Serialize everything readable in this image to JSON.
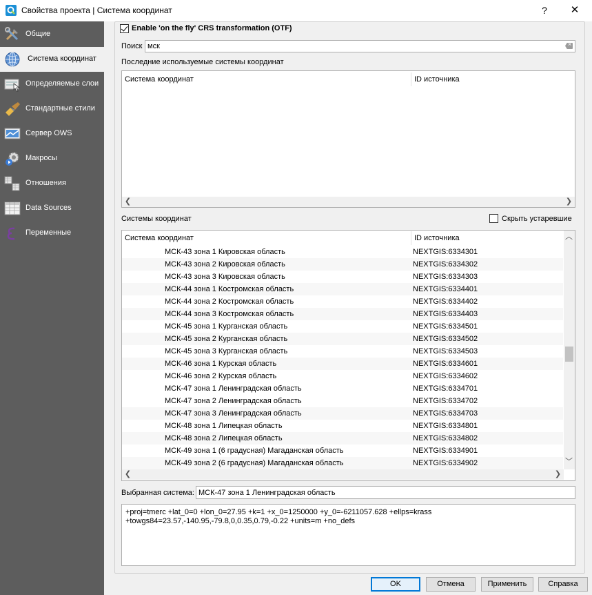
{
  "window": {
    "title": "Свойства проекта | Система координат",
    "help_label": "?",
    "close_label": "✕"
  },
  "sidebar": {
    "items": [
      {
        "label": "Общие",
        "icon": "tools-icon"
      },
      {
        "label": "Система координат",
        "icon": "globe-icon"
      },
      {
        "label": "Определяемые слои",
        "icon": "identify-layers-icon"
      },
      {
        "label": "Стандартные стили",
        "icon": "brush-icon"
      },
      {
        "label": "Сервер OWS",
        "icon": "ows-server-icon"
      },
      {
        "label": "Макросы",
        "icon": "macros-icon"
      },
      {
        "label": "Отношения",
        "icon": "relations-icon"
      },
      {
        "label": "Data Sources",
        "icon": "data-sources-icon"
      },
      {
        "label": "Переменные",
        "icon": "variables-icon"
      }
    ],
    "active_index": 1
  },
  "otf": {
    "label": "Enable 'on the fly' CRS transformation (OTF)",
    "checked": true
  },
  "search": {
    "label": "Поиск",
    "value": "мск"
  },
  "recent": {
    "label": "Последние используемые системы координат",
    "col_crs": "Система координат",
    "col_id": "ID источника"
  },
  "crs_list": {
    "label": "Системы координат",
    "hide_deprecated_label": "Скрыть устаревшие",
    "hide_deprecated_checked": false,
    "col_crs": "Система координат",
    "col_id": "ID источника",
    "rows": [
      {
        "name": "МСК-43 зона 1 Кировская область",
        "id": "NEXTGIS:6334301"
      },
      {
        "name": "МСК-43 зона 2 Кировская область",
        "id": "NEXTGIS:6334302"
      },
      {
        "name": "МСК-43 зона 3 Кировская область",
        "id": "NEXTGIS:6334303"
      },
      {
        "name": "МСК-44 зона 1 Костромская область",
        "id": "NEXTGIS:6334401"
      },
      {
        "name": "МСК-44 зона 2 Костромская область",
        "id": "NEXTGIS:6334402"
      },
      {
        "name": "МСК-44 зона 3 Костромская область",
        "id": "NEXTGIS:6334403"
      },
      {
        "name": "МСК-45 зона 1 Курганская область",
        "id": "NEXTGIS:6334501"
      },
      {
        "name": "МСК-45 зона 2 Курганская область",
        "id": "NEXTGIS:6334502"
      },
      {
        "name": "МСК-45 зона 3 Курганская область",
        "id": "NEXTGIS:6334503"
      },
      {
        "name": "МСК-46 зона 1 Курская область",
        "id": "NEXTGIS:6334601"
      },
      {
        "name": "МСК-46 зона 2 Курская область",
        "id": "NEXTGIS:6334602"
      },
      {
        "name": "МСК-47 зона 1 Ленинградская область",
        "id": "NEXTGIS:6334701"
      },
      {
        "name": "МСК-47 зона 2 Ленинградская область",
        "id": "NEXTGIS:6334702"
      },
      {
        "name": "МСК-47 зона 3 Ленинградская область",
        "id": "NEXTGIS:6334703"
      },
      {
        "name": "МСК-48 зона 1 Липецкая область",
        "id": "NEXTGIS:6334801"
      },
      {
        "name": "МСК-48 зона 2 Липецкая область",
        "id": "NEXTGIS:6334802"
      },
      {
        "name": "МСК-49 зона 1 (6 градусная) Магаданская область",
        "id": "NEXTGIS:6334901"
      },
      {
        "name": "МСК-49 зона 2 (6 градусная) Магаданская область",
        "id": "NEXTGIS:6334902"
      }
    ],
    "selected_index": 11
  },
  "selected": {
    "label": "Выбранная система:",
    "value": "МСК-47 зона 1 Ленинградская область",
    "proj_line1": "+proj=tmerc +lat_0=0 +lon_0=27.95 +k=1 +x_0=1250000 +y_0=-6211057.628 +ellps=krass",
    "proj_line2": "+towgs84=23.57,-140.95,-79.8,0,0.35,0.79,-0.22 +units=m +no_defs"
  },
  "buttons": {
    "ok": "OK",
    "cancel": "Отмена",
    "apply": "Применить",
    "help": "Справка"
  }
}
